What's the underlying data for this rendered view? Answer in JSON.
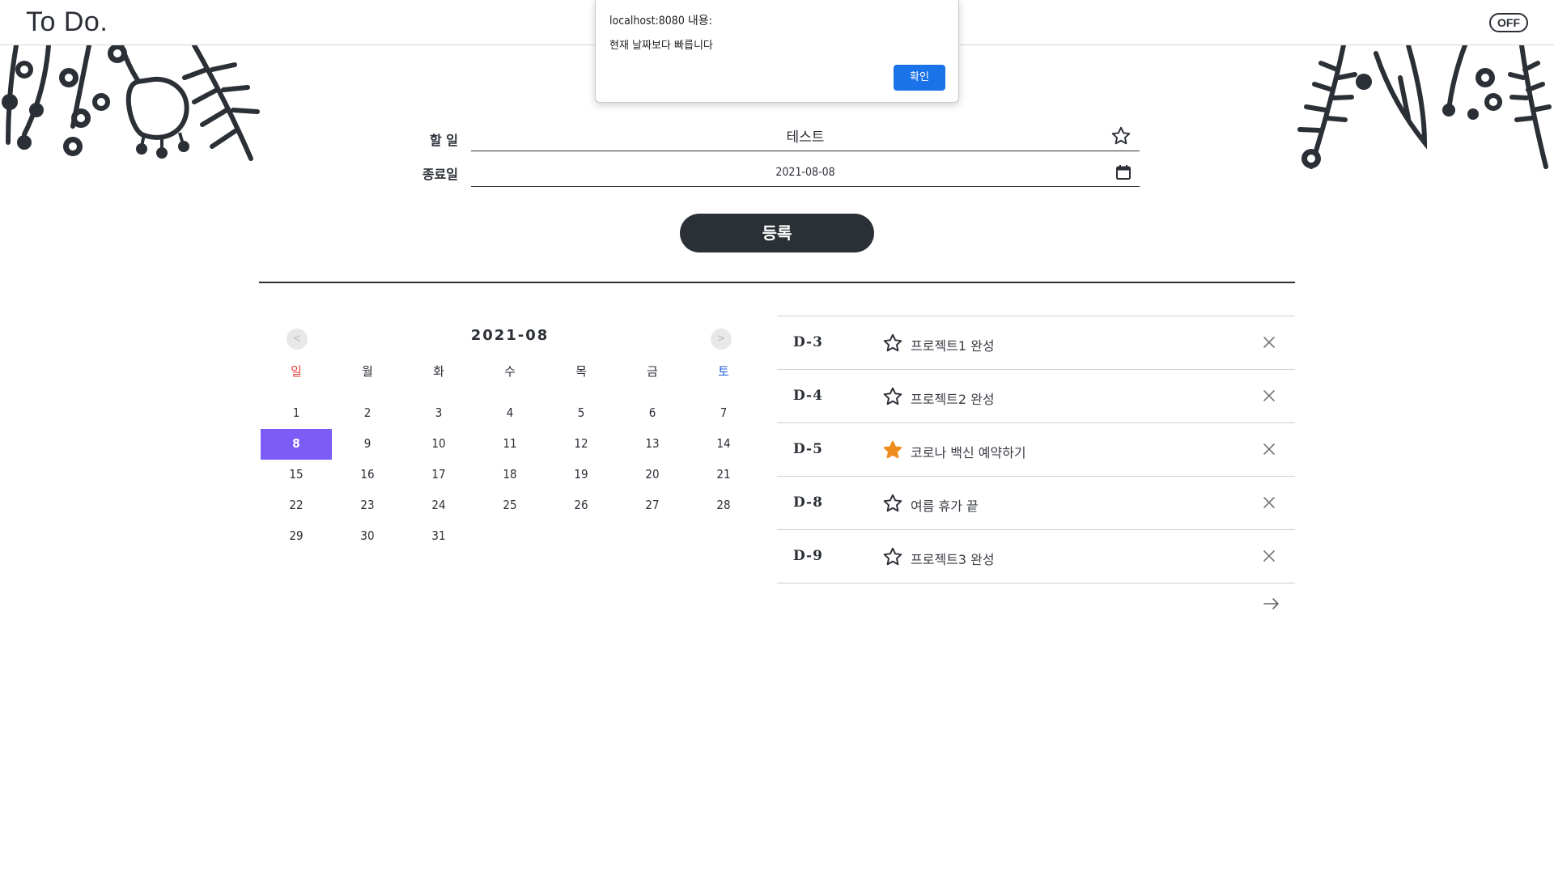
{
  "header": {
    "logo": "To Do.",
    "toggle_label": "OFF"
  },
  "form": {
    "task_label": "할 일",
    "task_value": "테스트",
    "task_starred": false,
    "due_label": "종료일",
    "due_value": "2021-08-08",
    "register_label": "등록"
  },
  "calendar": {
    "title": "2021-08",
    "prev_label": "<",
    "next_label": ">",
    "weekdays": [
      "일",
      "월",
      "화",
      "수",
      "목",
      "금",
      "토"
    ],
    "first_weekday_index": 0,
    "days_in_month": 31,
    "selected_day": 8
  },
  "todos": [
    {
      "dday": "D-3",
      "text": "프로젝트1 완성",
      "starred": false
    },
    {
      "dday": "D-4",
      "text": "프로젝트2 완성",
      "starred": false
    },
    {
      "dday": "D-5",
      "text": "코로나 백신 예약하기",
      "starred": true
    },
    {
      "dday": "D-8",
      "text": "여름 휴가 끝",
      "starred": false
    },
    {
      "dday": "D-9",
      "text": "프로젝트3 완성",
      "starred": false
    }
  ],
  "alert": {
    "title": "localhost:8080 내용:",
    "message": "현재 날짜보다 빠릅니다",
    "ok_label": "확인"
  },
  "colors": {
    "dark": "#2b2f36",
    "selected_day": "#7b5cf6",
    "star_active": "#f08c1e",
    "sunday": "#e53935",
    "saturday": "#1e5bd8",
    "alert_button": "#1a73e8"
  }
}
